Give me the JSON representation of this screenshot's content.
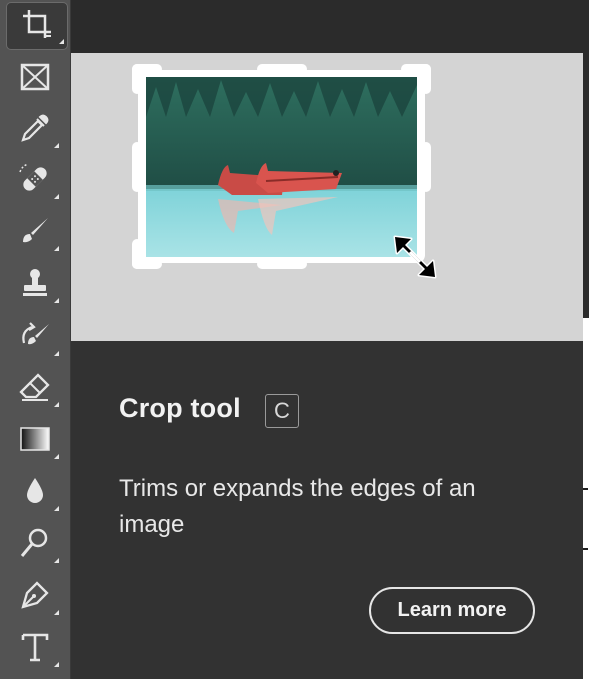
{
  "toolbar": {
    "tools": [
      {
        "name": "crop-tool",
        "icon": "crop-icon",
        "active": true
      },
      {
        "name": "frame-tool",
        "icon": "frame-icon"
      },
      {
        "name": "eyedropper-tool",
        "icon": "eyedropper-icon"
      },
      {
        "name": "spot-healing-tool",
        "icon": "bandage-icon"
      },
      {
        "name": "brush-tool",
        "icon": "brush-icon"
      },
      {
        "name": "clone-stamp-tool",
        "icon": "stamp-icon"
      },
      {
        "name": "history-brush-tool",
        "icon": "history-brush-icon"
      },
      {
        "name": "eraser-tool",
        "icon": "eraser-icon"
      },
      {
        "name": "gradient-tool",
        "icon": "gradient-icon"
      },
      {
        "name": "blur-tool",
        "icon": "drop-icon"
      },
      {
        "name": "dodge-tool",
        "icon": "dodge-icon"
      },
      {
        "name": "pen-tool",
        "icon": "pen-icon"
      },
      {
        "name": "type-tool",
        "icon": "type-icon"
      }
    ]
  },
  "tooltip": {
    "title": "Crop tool",
    "shortcut": "C",
    "description": "Trims or expands the edges of an image",
    "learn_more_label": "Learn more"
  },
  "colors": {
    "toolbar_bg": "#535353",
    "panel_bg": "#323232",
    "preview_bg": "#d4d4d4"
  }
}
